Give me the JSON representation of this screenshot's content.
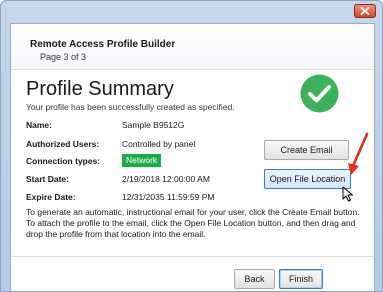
{
  "window": {
    "header_title": "Remote Access Profile Builder",
    "header_page": "Page 3 of 3"
  },
  "summary": {
    "title": "Profile Summary",
    "subtitle": "Your profile has been successfully created as specified."
  },
  "fields": [
    {
      "label": "Name:",
      "value": "Sample B9512G"
    },
    {
      "label": "Authorized Users:",
      "value": "Controlled by panel"
    },
    {
      "label": "Connection types:",
      "value": "Network"
    },
    {
      "label": "Start Date:",
      "value": "2/19/2018 12:00:00 AM"
    },
    {
      "label": "Expire Date:",
      "value": "12/31/2035 11:59:59 PM"
    }
  ],
  "buttons": {
    "create_email": "Create Email",
    "open_file_location": "Open File Location",
    "back": "Back",
    "finish": "Finish"
  },
  "info_lines": [
    "To generate an automatic, instructional email for your user, click the Create Email button.",
    "To attach the profile to the email, click the Open File Location button, and then drag and",
    "drop the profile from that location into the email."
  ],
  "icons": {
    "success": "check-circle-icon",
    "close": "close-icon",
    "annotation": "red-arrow-icon",
    "cursor": "mouse-pointer-icon"
  },
  "colors": {
    "success_green": "#3cb15b",
    "network_badge": "#1aab4a",
    "annotation_red": "#e0301e",
    "primary_button_border": "#3c7fb1"
  }
}
